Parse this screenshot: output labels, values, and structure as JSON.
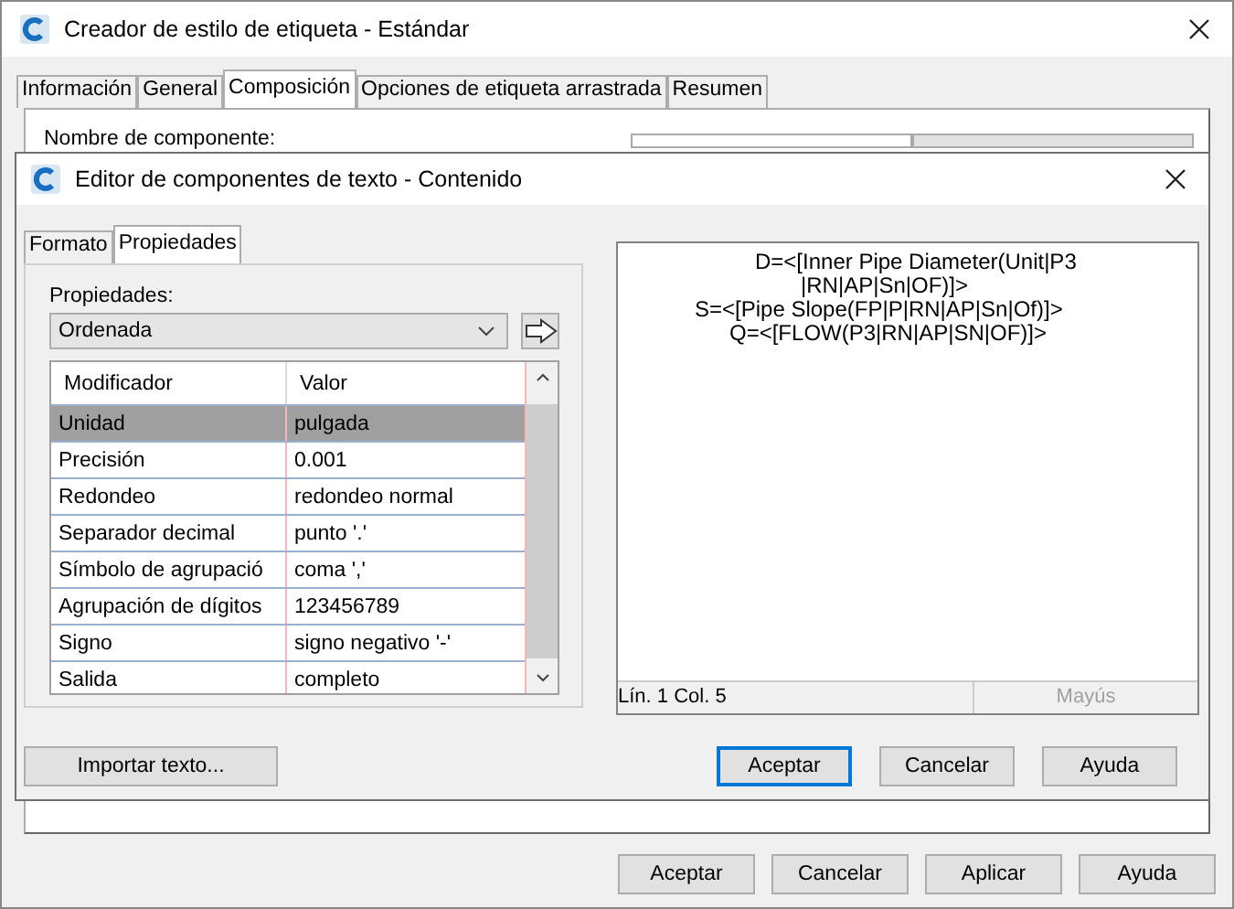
{
  "window": {
    "title": "Creador de estilo de etiqueta - Estándar"
  },
  "tabs": [
    {
      "label": "Información",
      "selected": false
    },
    {
      "label": "General",
      "selected": false
    },
    {
      "label": "Composición",
      "selected": true
    },
    {
      "label": "Opciones de etiqueta arrastrada",
      "selected": false
    },
    {
      "label": "Resumen",
      "selected": false
    }
  ],
  "component_name_label": "Nombre de componente:",
  "buttons": [
    {
      "label": "Aceptar"
    },
    {
      "label": "Cancelar"
    },
    {
      "label": "Aplicar"
    },
    {
      "label": "Ayuda"
    }
  ],
  "dialog": {
    "title": "Editor de componentes de texto - Contenido",
    "tabs": [
      {
        "label": "Formato",
        "selected": false
      },
      {
        "label": "Propiedades",
        "selected": true
      }
    ],
    "properties_label": "Propiedades:",
    "properties_value": "Ordenada",
    "table": {
      "columns": [
        "Modificador",
        "Valor"
      ],
      "rows": [
        {
          "cells": [
            "Unidad",
            "pulgada"
          ],
          "selected": true
        },
        {
          "cells": [
            "Precisión",
            "0.001"
          ],
          "selected": false
        },
        {
          "cells": [
            "Redondeo",
            "redondeo normal"
          ],
          "selected": false
        },
        {
          "cells": [
            "Separador decimal",
            "punto '.'"
          ],
          "selected": false
        },
        {
          "cells": [
            "Símbolo de agrupació",
            "coma ','"
          ],
          "selected": false
        },
        {
          "cells": [
            "Agrupación de dígitos",
            "123456789"
          ],
          "selected": false
        },
        {
          "cells": [
            "Signo",
            "signo negativo '-'"
          ],
          "selected": false
        },
        {
          "cells": [
            "Salida",
            "completo"
          ],
          "selected": false
        }
      ]
    },
    "editor_lines": [
      "D=<[Inner Pipe Diameter(Unit|P3",
      "|RN|AP|Sn|OF)]>",
      "S=<[Pipe Slope(FP|P|RN|AP|Sn|Of)]>",
      "Q=<[FLOW(P3|RN|AP|SN|OF)]>"
    ],
    "status": {
      "position": "Lín. 1 Col. 5",
      "caps": "Mayús",
      "caps_active": false
    },
    "import_button": "Importar texto...",
    "buttons": [
      {
        "label": "Aceptar",
        "focused": true
      },
      {
        "label": "Cancelar",
        "focused": false
      },
      {
        "label": "Ayuda",
        "focused": false
      }
    ]
  }
}
